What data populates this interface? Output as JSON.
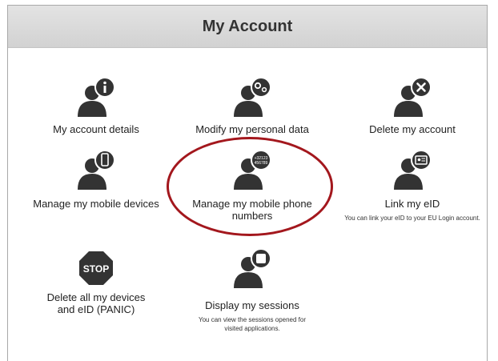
{
  "page": {
    "title": "My Account"
  },
  "tiles": [
    {
      "label": "My account details",
      "desc": "",
      "icon": "person-info-icon"
    },
    {
      "label": "Modify my personal data",
      "desc": "",
      "icon": "person-gears-icon"
    },
    {
      "label": "Delete my account",
      "desc": "",
      "icon": "person-delete-icon"
    },
    {
      "label": "Manage my mobile devices",
      "desc": "",
      "icon": "person-mobile-icon"
    },
    {
      "label": "Manage my mobile phone numbers",
      "desc": "",
      "icon": "person-phone-number-icon",
      "bubble_text_1": "+32123",
      "bubble_text_2": "456789"
    },
    {
      "label": "Link my eID",
      "desc": "You can link your eID to your EU Login account.",
      "icon": "person-id-card-icon"
    },
    {
      "label": "Delete all my devices and eID (PANIC)",
      "desc": "",
      "icon": "stop-sign-icon",
      "sign_text": "STOP"
    },
    {
      "label": "Display my sessions",
      "desc": "You can view the sessions opened for visited applications.",
      "icon": "person-session-icon"
    }
  ],
  "colors": {
    "icon": "#333333",
    "stop": "#333333",
    "highlight": "#a3171d",
    "header_bg": "#d9d9d9"
  }
}
